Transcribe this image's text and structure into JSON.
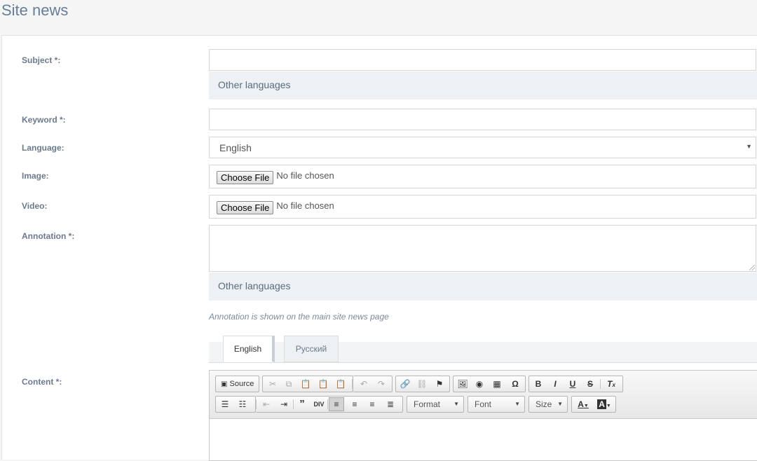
{
  "header": {
    "title": "Site news"
  },
  "form": {
    "subject_label": "Subject *:",
    "other_languages": "Other languages",
    "keyword_label": "Keyword *:",
    "language_label": "Language:",
    "language_value": "English",
    "image_label": "Image:",
    "video_label": "Video:",
    "choose_file": "Choose File",
    "no_file": "No file chosen",
    "annotation_label": "Annotation *:",
    "annotation_hint": "Annotation is shown on the main site news page",
    "content_label": "Content *:"
  },
  "tabs": [
    {
      "label": "English",
      "active": true
    },
    {
      "label": "Русский",
      "active": false
    }
  ],
  "editor": {
    "source_label": "Source",
    "format_label": "Format",
    "font_label": "Font",
    "size_label": "Size"
  }
}
